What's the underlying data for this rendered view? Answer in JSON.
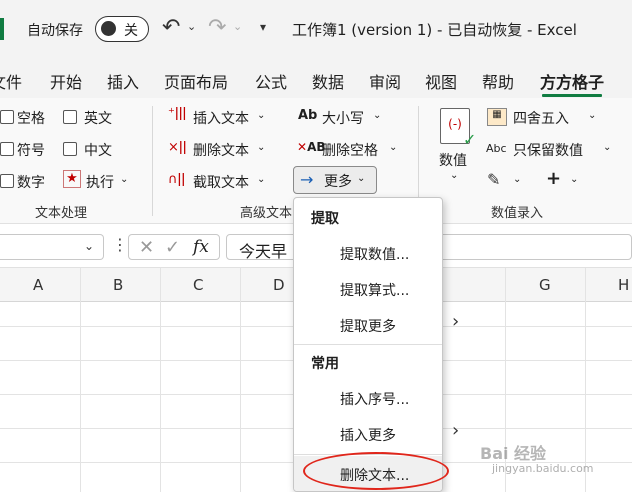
{
  "titlebar": {
    "autosave_label": "自动保存",
    "toggle_state": "关",
    "document_title": "工作簿1 (version 1)  -  已自动恢复  -  Excel"
  },
  "tabs": [
    {
      "label": "文件"
    },
    {
      "label": "开始"
    },
    {
      "label": "插入"
    },
    {
      "label": "页面布局"
    },
    {
      "label": "公式"
    },
    {
      "label": "数据"
    },
    {
      "label": "审阅"
    },
    {
      "label": "视图"
    },
    {
      "label": "帮助"
    },
    {
      "label": "方方格子",
      "active": true
    }
  ],
  "ribbon": {
    "text_group": {
      "label": "文本处理",
      "checkboxes": [
        "空格",
        "英文",
        "符号",
        "中文",
        "数字"
      ],
      "execute_label": "执行"
    },
    "advanced_group": {
      "label": "高级文本",
      "insert_text": "插入文本",
      "delete_text": "删除文本",
      "extract_text": "截取文本",
      "case_label": "大小写",
      "delete_spaces": "删除空格",
      "more_label": "更多"
    },
    "number_group": {
      "label": "数值录入",
      "number_label": "数值",
      "round_label": "四舍五入",
      "keep_numbers": "只保留数值"
    }
  },
  "formula_bar": {
    "fx_label": "fx",
    "content": "今天早"
  },
  "columns": [
    "A",
    "B",
    "C",
    "D",
    "G",
    "H"
  ],
  "menu": {
    "section1_title": "提取",
    "section1_items": [
      "提取数值...",
      "提取算式...",
      "提取更多"
    ],
    "section2_title": "常用",
    "section2_items": [
      "插入序号...",
      "插入更多"
    ],
    "last_item": "删除文本..."
  },
  "watermark": {
    "text": "Bai 经验",
    "url": "jingyan.baidu.com"
  },
  "colors": {
    "accent": "#107c41",
    "highlight": "#e0261b"
  }
}
